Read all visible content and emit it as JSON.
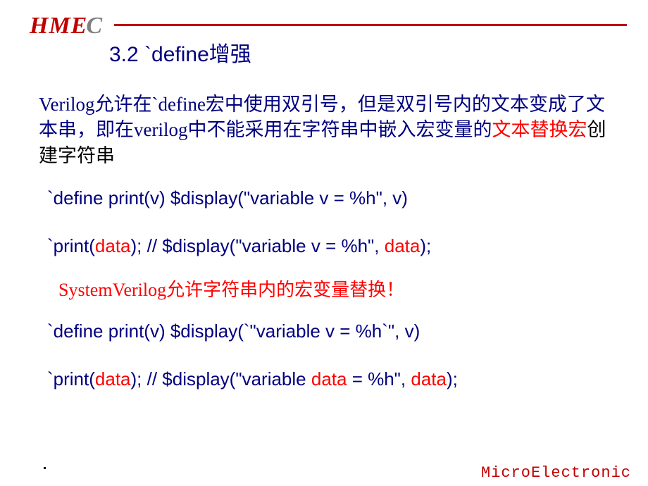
{
  "logo": {
    "main": "HME",
    "suffix": "C"
  },
  "title": "3.2 `define增强",
  "intro": {
    "p1a": "Verilog允许在`define宏中使用双引号，但是双引号内的文本变成了文本串，即在verilog中不能采用在字符串中嵌入宏变量的",
    "p1b": "文本替换宏",
    "p1c": "创建字符串"
  },
  "code1": {
    "a": "`define print(v)  $display(\"variable v = %h\", v)"
  },
  "code2": {
    "a": "`print(",
    "b": "data",
    "c": ");   // $display(\"variable v = %h\", ",
    "d": "data",
    "e": ");"
  },
  "sv_note": "SystemVerilog允许字符串内的宏变量替换！",
  "code3": {
    "a": "`define print(v)  $display(`\"variable v = %h`\", v)"
  },
  "code4": {
    "a": "`print(",
    "b": "data",
    "c": ");   // $display(\"variable ",
    "d": "data",
    "e": " = %h\", ",
    "f": "data",
    "g": ");"
  },
  "footer": "MicroElectronic"
}
